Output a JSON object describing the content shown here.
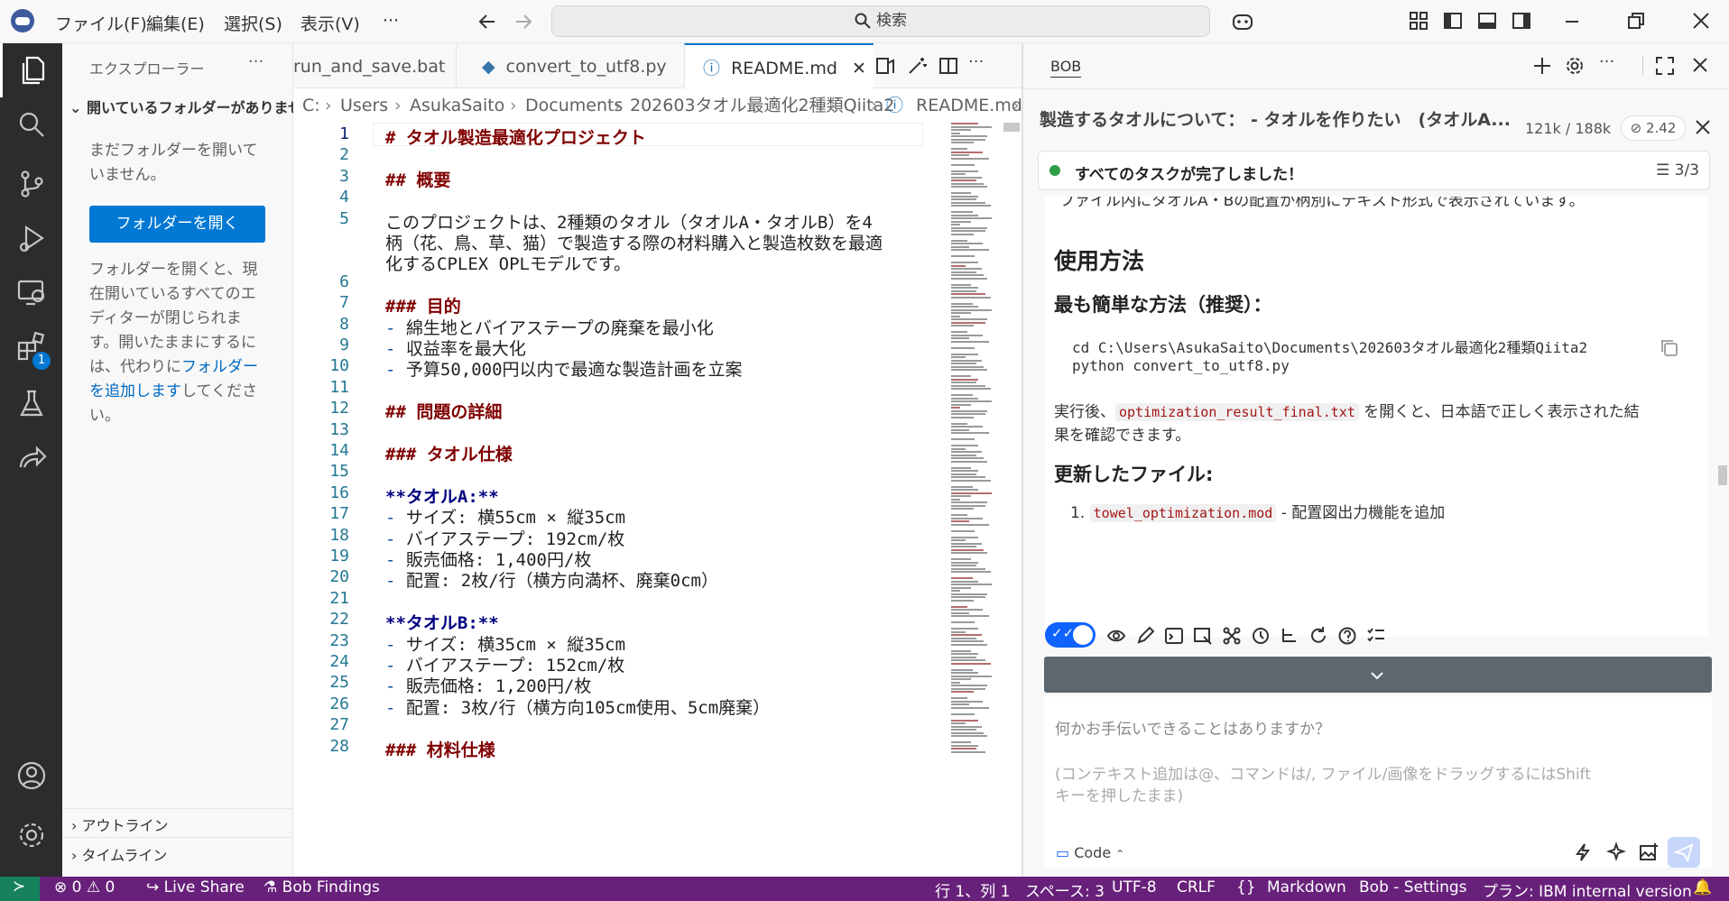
{
  "titlebar": {
    "menu": [
      "ファイル(F)",
      "編集(E)",
      "選択(S)",
      "表示(V)",
      "···"
    ],
    "search_placeholder": "検索"
  },
  "sidebar": {
    "title": "エクスプローラー",
    "more": "···",
    "section": "開いているフォルダーがありません",
    "no_folder_text": "まだフォルダーを開いていません。",
    "open_button": "フォルダーを開く",
    "info_text_1": "フォルダーを開くと、現在開いているすべてのエディターが閉じられます。開いたままにするには、代わりに",
    "info_link": "フォルダーを追加します",
    "info_text_2": "してください。",
    "outline": "アウトライン",
    "timeline": "タイムライン",
    "badge_count": "1"
  },
  "tabs": [
    {
      "label": "run_and_save.bat"
    },
    {
      "label": "convert_to_utf8.py"
    },
    {
      "label": "README.md",
      "active": true
    }
  ],
  "breadcrumb": [
    "C:",
    "Users",
    "AsukaSaito",
    "Documents",
    "202603タオル最適化2種類Qiita2",
    "README.md",
    "..."
  ],
  "code_lines": [
    {
      "n": "1",
      "t": "# タオル製造最適化プロジェクト",
      "k": "h"
    },
    {
      "n": "2",
      "t": "",
      "k": ""
    },
    {
      "n": "3",
      "t": "## 概要",
      "k": "h"
    },
    {
      "n": "4",
      "t": "",
      "k": ""
    },
    {
      "n": "5",
      "t": "このプロジェクトは、2種類のタオル（タオルA・タオルB）を4",
      "k": ""
    },
    {
      "n": "",
      "t": "柄（花、鳥、草、猫）で製造する際の材料購入と製造枚数を最適",
      "k": ""
    },
    {
      "n": "",
      "t": "化するCPLEX OPLモデルです。",
      "k": ""
    },
    {
      "n": "6",
      "t": "",
      "k": ""
    },
    {
      "n": "7",
      "t": "### 目的",
      "k": "h"
    },
    {
      "n": "8",
      "t": "- 綿生地とバイアステープの廃棄を最小化",
      "k": "li"
    },
    {
      "n": "9",
      "t": "- 収益率を最大化",
      "k": "li"
    },
    {
      "n": "10",
      "t": "- 予算50,000円以内で最適な製造計画を立案",
      "k": "li"
    },
    {
      "n": "11",
      "t": "",
      "k": ""
    },
    {
      "n": "12",
      "t": "## 問題の詳細",
      "k": "h"
    },
    {
      "n": "13",
      "t": "",
      "k": ""
    },
    {
      "n": "14",
      "t": "### タオル仕様",
      "k": "h"
    },
    {
      "n": "15",
      "t": "",
      "k": ""
    },
    {
      "n": "16",
      "t": "**タオルA:**",
      "k": "b"
    },
    {
      "n": "17",
      "t": "- サイズ: 横55cm × 縦35cm",
      "k": "li"
    },
    {
      "n": "18",
      "t": "- バイアステープ: 192cm/枚",
      "k": "li"
    },
    {
      "n": "19",
      "t": "- 販売価格: 1,400円/枚",
      "k": "li"
    },
    {
      "n": "20",
      "t": "- 配置: 2枚/行（横方向満杯、廃棄0cm）",
      "k": "li"
    },
    {
      "n": "21",
      "t": "",
      "k": ""
    },
    {
      "n": "22",
      "t": "**タオルB:**",
      "k": "b"
    },
    {
      "n": "23",
      "t": "- サイズ: 横35cm × 縦35cm",
      "k": "li"
    },
    {
      "n": "24",
      "t": "- バイアステープ: 152cm/枚",
      "k": "li"
    },
    {
      "n": "25",
      "t": "- 販売価格: 1,200円/枚",
      "k": "li"
    },
    {
      "n": "26",
      "t": "- 配置: 3枚/行（横方向105cm使用、5cm廃棄）",
      "k": "li"
    },
    {
      "n": "27",
      "t": "",
      "k": ""
    },
    {
      "n": "28",
      "t": "### 材料仕様",
      "k": "h"
    }
  ],
  "bob": {
    "tab_label": "BOB",
    "task_title": "製造するタオルについて： - タオルを作りたい　(タオルA...",
    "tokens": "121k / 188k",
    "cost": "2.42",
    "done_text": "すべてのタスクが完了しました！",
    "done_count": "3/3",
    "cut_line": "ファイル内にタオルA・Bの配置が柄別にテキスト形式で表示されています。",
    "h_usage": "使用方法",
    "h_easiest": "最も簡単な方法（推奨）：",
    "cmd1": "cd C:\\Users\\AsukaSaito\\Documents\\202603タオル最適化2種類Qiita2",
    "cmd2": "python convert_to_utf8.py",
    "after_1": "実行後、",
    "after_file": "optimization_result_final.txt",
    "after_2": " を開くと、日本語で正しく表示された結",
    "after_3": "果を確認できます。",
    "h_updated": "更新したファイル:",
    "list_num": "1.",
    "list_file": "towel_optimization.mod",
    "list_desc": " - 配置図出力機能を追加",
    "input_placeholder": "何かお手伝いできることはありますか？",
    "input_hint_1": "(コンテキスト追加は@、コマンドは/, ファイル/画像をドラッグするにはShift",
    "input_hint_2": "キーを押したまま)",
    "mode": "Code"
  },
  "status": {
    "errors": "0",
    "warnings": "0",
    "live_share": "Live Share",
    "bob_findings": "Bob Findings",
    "position": "行 1、列 1",
    "spaces": "スペース: 3",
    "encoding": "UTF-8",
    "eol": "CRLF",
    "braces": "{}",
    "language": "Markdown",
    "bob_settings": "Bob - Settings",
    "plan": "プラン: IBM internal version"
  }
}
